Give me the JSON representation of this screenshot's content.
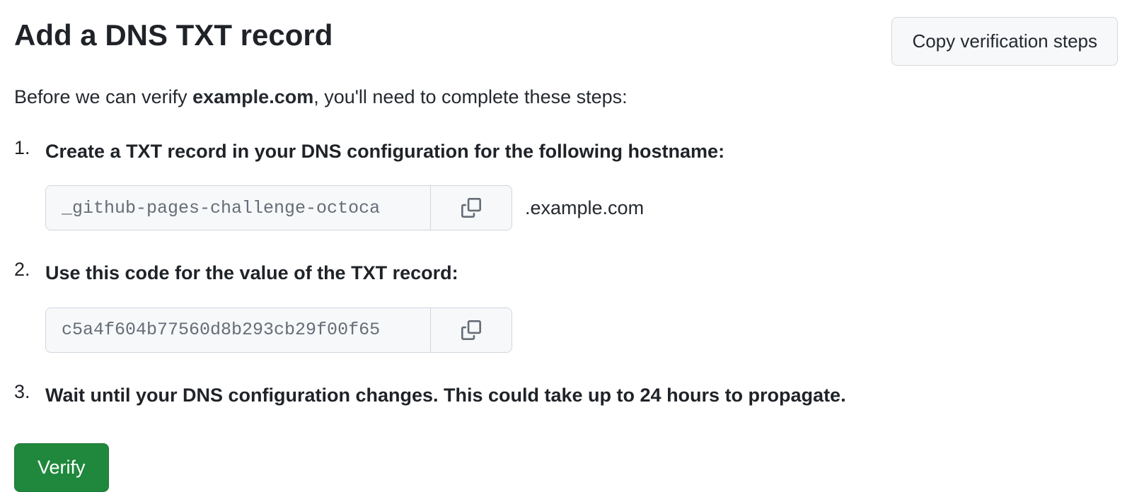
{
  "header": {
    "title": "Add a DNS TXT record",
    "copy_button": "Copy verification steps"
  },
  "intro": {
    "prefix": "Before we can verify ",
    "domain": "example.com",
    "suffix": ", you'll need to complete these steps:"
  },
  "steps": {
    "step1": {
      "title": "Create a TXT record in your DNS configuration for the following hostname:",
      "value": "_github-pages-challenge-octoca",
      "suffix": ".example.com"
    },
    "step2": {
      "title": "Use this code for the value of the TXT record:",
      "value": "c5a4f604b77560d8b293cb29f00f65"
    },
    "step3": {
      "title": "Wait until your DNS configuration changes. This could take up to 24 hours to propagate."
    }
  },
  "verify_button": "Verify"
}
